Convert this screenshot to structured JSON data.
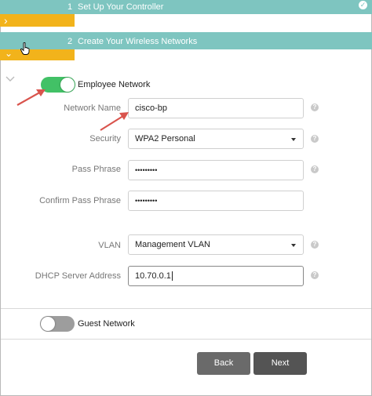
{
  "steps": [
    {
      "number": "1",
      "title": "Set Up Your Controller",
      "completed": true
    },
    {
      "number": "2",
      "title": "Create Your Wireless Networks",
      "completed": false
    }
  ],
  "employee_network": {
    "label": "Employee Network",
    "enabled": true,
    "fields": {
      "network_name": {
        "label": "Network Name",
        "value": "cisco-bp"
      },
      "security": {
        "label": "Security",
        "value": "WPA2 Personal"
      },
      "pass_phrase": {
        "label": "Pass Phrase",
        "value": "•••••••••"
      },
      "confirm_pass_phrase": {
        "label": "Confirm Pass Phrase",
        "value": "•••••••••"
      },
      "vlan": {
        "label": "VLAN",
        "value": "Management VLAN"
      },
      "dhcp_server": {
        "label": "DHCP Server Address",
        "value": "10.70.0.1"
      }
    }
  },
  "guest_network": {
    "label": "Guest Network",
    "enabled": false
  },
  "buttons": {
    "back": "Back",
    "next": "Next"
  },
  "icons": {
    "step_complete": "check-circle-icon",
    "expand": "chevron-right-icon",
    "collapse": "chevron-down-icon",
    "help": "question-circle-icon",
    "dropdown": "caret-down-icon",
    "annotation": "red-arrow",
    "cursor": "hand-pointer-icon"
  },
  "colors": {
    "step_bar": "#7ec5c0",
    "step_tab": "#f2b31b",
    "toggle_on": "#42c166",
    "toggle_off": "#9d9d9d",
    "button": "#5e5e5e",
    "annotation_arrow": "#d9544d"
  }
}
